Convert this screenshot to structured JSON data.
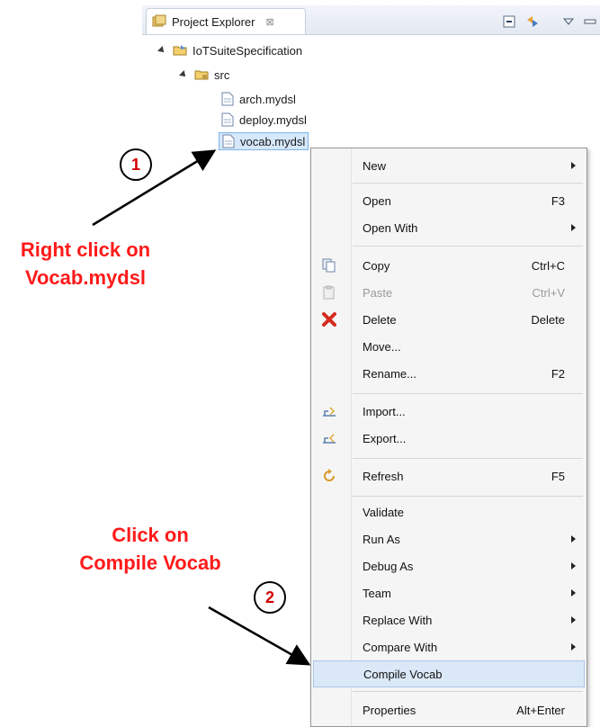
{
  "explorer": {
    "tab_label": "Project Explorer",
    "tab_close": "⊠",
    "project": "IoTSuiteSpecification",
    "folder": "src",
    "files": [
      "arch.mydsl",
      "deploy.mydsl",
      "vocab.mydsl"
    ]
  },
  "menu": {
    "items": [
      {
        "label": "New",
        "accel": "",
        "submenu": true
      },
      {
        "label": "Open",
        "accel": "F3",
        "submenu": false
      },
      {
        "label": "Open With",
        "accel": "",
        "submenu": true
      },
      {
        "label": "Copy",
        "accel": "Ctrl+C",
        "submenu": false
      },
      {
        "label": "Paste",
        "accel": "Ctrl+V",
        "submenu": false,
        "disabled": true
      },
      {
        "label": "Delete",
        "accel": "Delete",
        "submenu": false
      },
      {
        "label": "Move...",
        "accel": "",
        "submenu": false
      },
      {
        "label": "Rename...",
        "accel": "F2",
        "submenu": false
      },
      {
        "label": "Import...",
        "accel": "",
        "submenu": false
      },
      {
        "label": "Export...",
        "accel": "",
        "submenu": false
      },
      {
        "label": "Refresh",
        "accel": "F5",
        "submenu": false
      },
      {
        "label": "Validate",
        "accel": "",
        "submenu": false
      },
      {
        "label": "Run As",
        "accel": "",
        "submenu": true
      },
      {
        "label": "Debug As",
        "accel": "",
        "submenu": true
      },
      {
        "label": "Team",
        "accel": "",
        "submenu": true
      },
      {
        "label": "Replace With",
        "accel": "",
        "submenu": true
      },
      {
        "label": "Compare With",
        "accel": "",
        "submenu": true
      },
      {
        "label": "Compile Vocab",
        "accel": "",
        "submenu": false
      },
      {
        "label": "Properties",
        "accel": "Alt+Enter",
        "submenu": false
      }
    ]
  },
  "annotations": {
    "step1": "1",
    "step1_text_line1": "Right click on",
    "step1_text_line2": "Vocab.mydsl",
    "step2": "2",
    "step2_text_line1": "Click on",
    "step2_text_line2": "Compile Vocab"
  },
  "colors": {
    "annotation_red": "#ff1a1a",
    "selection": "#d6e8fb",
    "menu_highlight": "#dbe8f7"
  }
}
